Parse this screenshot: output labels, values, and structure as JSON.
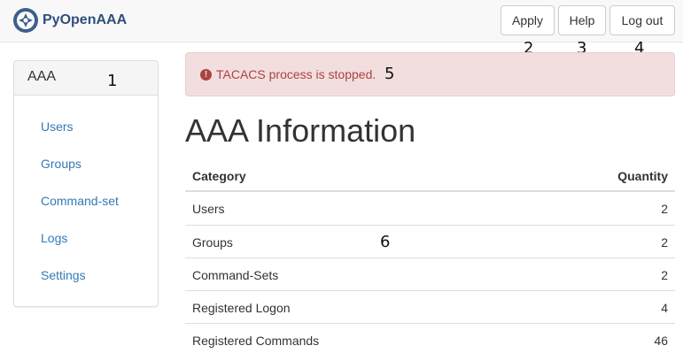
{
  "brand": {
    "name": "PyOpenAAA"
  },
  "toolbar": {
    "apply_label": "Apply",
    "help_label": "Help",
    "logout_label": "Log out"
  },
  "sidebar": {
    "heading": "AAA",
    "items": [
      {
        "label": "Users"
      },
      {
        "label": "Groups"
      },
      {
        "label": "Command-set"
      },
      {
        "label": "Logs"
      },
      {
        "label": "Settings"
      }
    ]
  },
  "alert": {
    "icon": "exclamation-circle-icon",
    "message": "TACACS process is stopped."
  },
  "main": {
    "title": "AAA Information",
    "table": {
      "headers": [
        "Category",
        "Quantity"
      ],
      "rows": [
        [
          "Users",
          "2"
        ],
        [
          "Groups",
          "2"
        ],
        [
          "Command-Sets",
          "2"
        ],
        [
          "Registered Logon",
          "4"
        ],
        [
          "Registered Commands",
          "46"
        ]
      ]
    }
  },
  "annotations": [
    "1",
    "2",
    "3",
    "4",
    "5",
    "6"
  ],
  "colors": {
    "link": "#337ab7",
    "alert_text": "#a94442",
    "alert_bg": "#f2dede",
    "navbar_bg": "#f8f8f8",
    "brand": "#2f4f7a"
  }
}
